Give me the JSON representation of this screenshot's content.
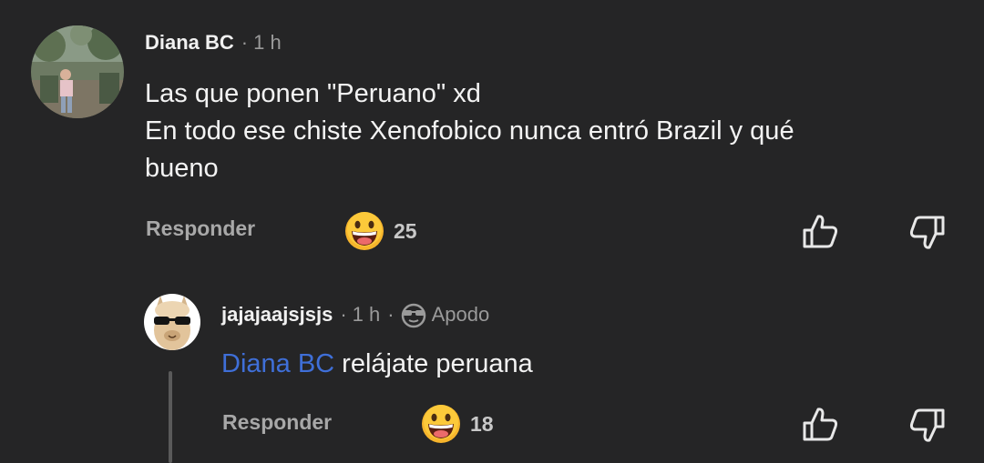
{
  "comment": {
    "author": "Diana BC",
    "separator": "·",
    "time": "1 h",
    "lines": [
      "Las que ponen \"Peruano\" xd",
      "En todo ese chiste Xenofobico nunca entró Brazil y qué",
      "bueno"
    ],
    "reply_label": "Responder",
    "reaction_count": "25",
    "reaction_icon": "grinning-face-emoji",
    "like_icon": "thumbs-up-icon",
    "dislike_icon": "thumbs-down-icon"
  },
  "reply": {
    "author": "jajajaajsjsjs",
    "separator": "·",
    "time": "1 h",
    "separator2": "·",
    "nickname_label": "Apodo",
    "mention": "Diana BC",
    "text": " relájate peruana",
    "reply_label": "Responder",
    "reaction_count": "18",
    "reaction_icon": "grinning-face-emoji",
    "like_icon": "thumbs-up-icon",
    "dislike_icon": "thumbs-down-icon"
  },
  "colors": {
    "background": "#252526",
    "mention": "#3f6fd8",
    "muted": "#9a9a9a"
  }
}
